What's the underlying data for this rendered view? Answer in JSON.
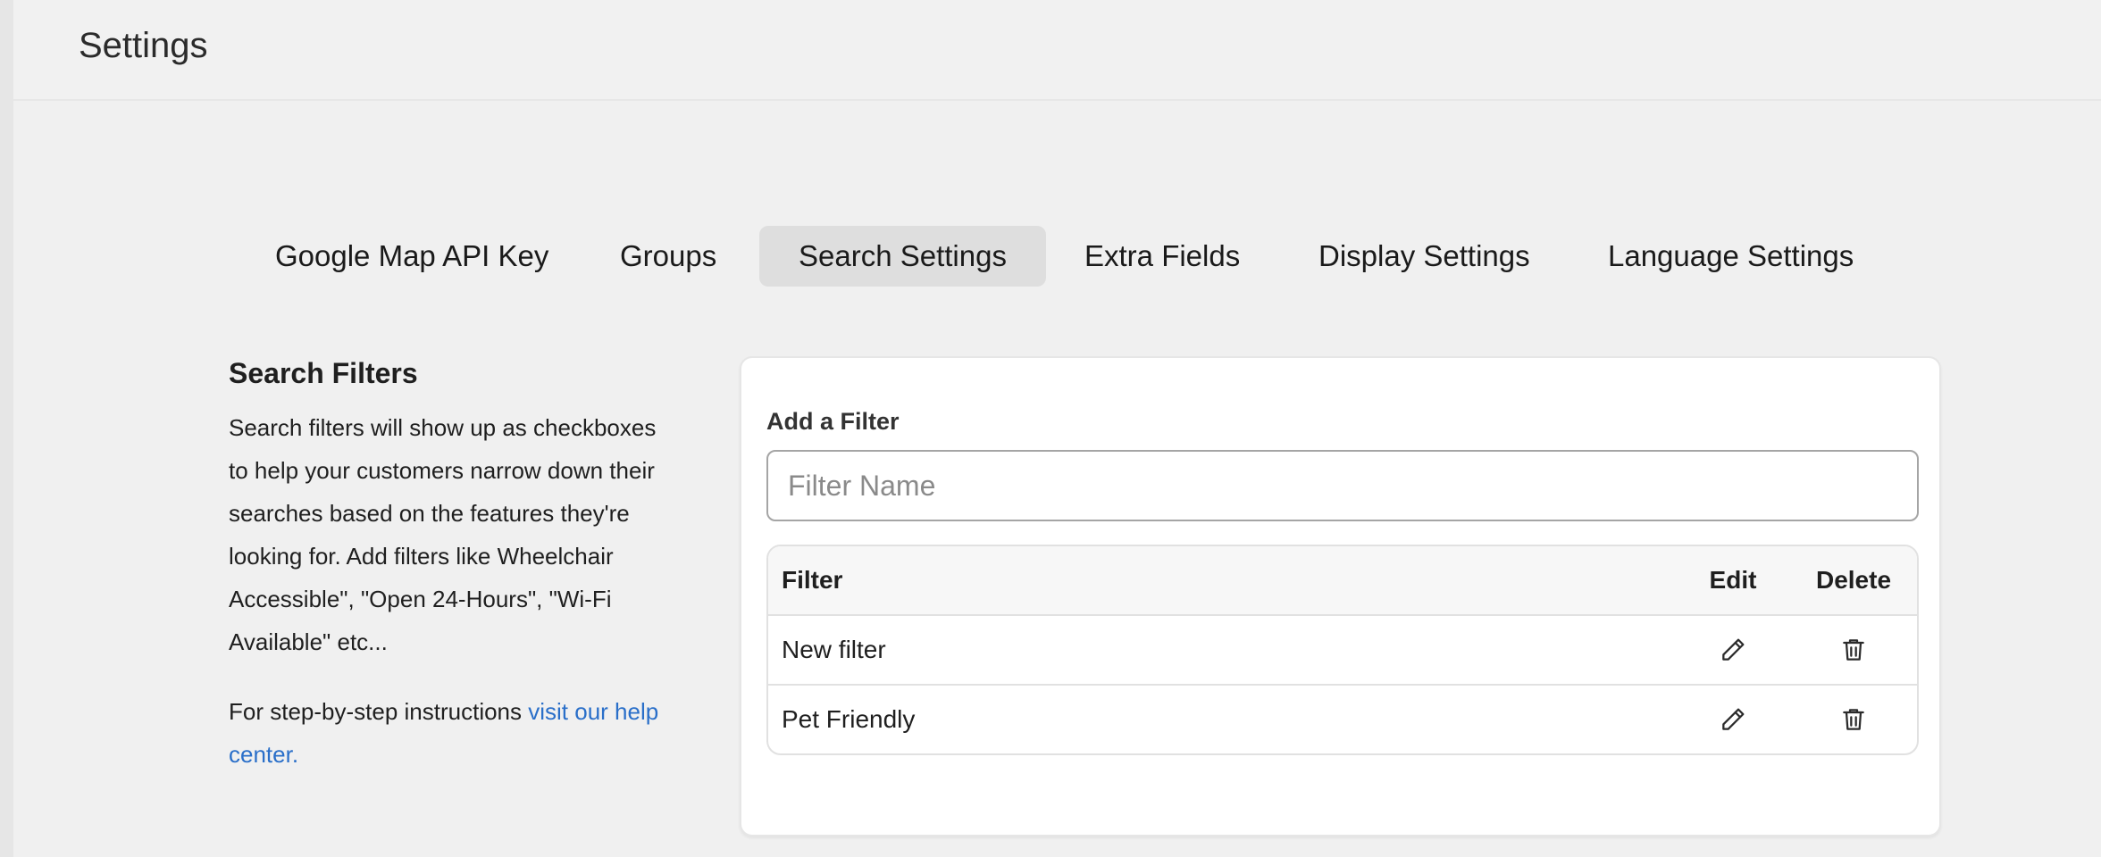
{
  "header": {
    "title": "Settings"
  },
  "tabs": [
    {
      "label": "Google Map API Key",
      "active": false
    },
    {
      "label": "Groups",
      "active": false
    },
    {
      "label": "Search Settings",
      "active": true
    },
    {
      "label": "Extra Fields",
      "active": false
    },
    {
      "label": "Display Settings",
      "active": false
    },
    {
      "label": "Language Settings",
      "active": false
    }
  ],
  "sidebar": {
    "heading": "Search Filters",
    "description": "Search filters will show up as checkboxes to help your customers narrow down their searches based on the features they're looking for. Add filters like Wheelchair Accessible\", \"Open 24-Hours\", \"Wi-Fi Available\" etc...",
    "help_prefix": "For step-by-step instructions ",
    "help_link": "visit our help center."
  },
  "form": {
    "label": "Add a Filter",
    "input_placeholder": "Filter Name",
    "input_value": ""
  },
  "table": {
    "headers": {
      "name": "Filter",
      "edit": "Edit",
      "delete": "Delete"
    },
    "rows": [
      {
        "name": "New filter",
        "edit_icon": "pencil-icon",
        "delete_icon": "trash-icon"
      },
      {
        "name": "Pet Friendly",
        "edit_icon": "pencil-icon",
        "delete_icon": "trash-icon"
      }
    ]
  },
  "colors": {
    "link": "#2a6fc9",
    "active_tab_bg": "#dedede",
    "page_bg": "#f0f0f0"
  }
}
